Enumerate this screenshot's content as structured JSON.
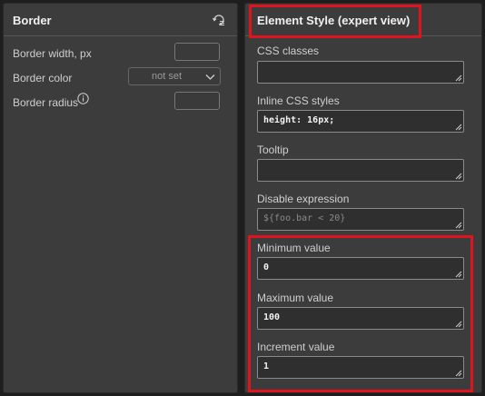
{
  "border_panel": {
    "title": "Border",
    "reset_icon": "reset-icon",
    "rows": {
      "width_label": "Border width, px",
      "color_label": "Border color",
      "color_value": "not set",
      "radius_label": "Border radius"
    },
    "info_icon": "info-icon"
  },
  "style_panel": {
    "title": "Element Style (expert view)",
    "fields": {
      "css_classes": {
        "label": "CSS classes",
        "value": ""
      },
      "inline_css": {
        "label": "Inline CSS styles",
        "value": "height: 16px;"
      },
      "tooltip": {
        "label": "Tooltip",
        "value": ""
      },
      "disable_expression": {
        "label": "Disable expression",
        "value": "",
        "placeholder": "${foo.bar < 20}"
      },
      "minimum_value": {
        "label": "Minimum value",
        "value": "0"
      },
      "maximum_value": {
        "label": "Maximum value",
        "value": "100"
      },
      "increment_value": {
        "label": "Increment value",
        "value": "1"
      }
    }
  },
  "colors": {
    "panel_bg": "#3c3c3c",
    "highlight": "#e0141e"
  }
}
